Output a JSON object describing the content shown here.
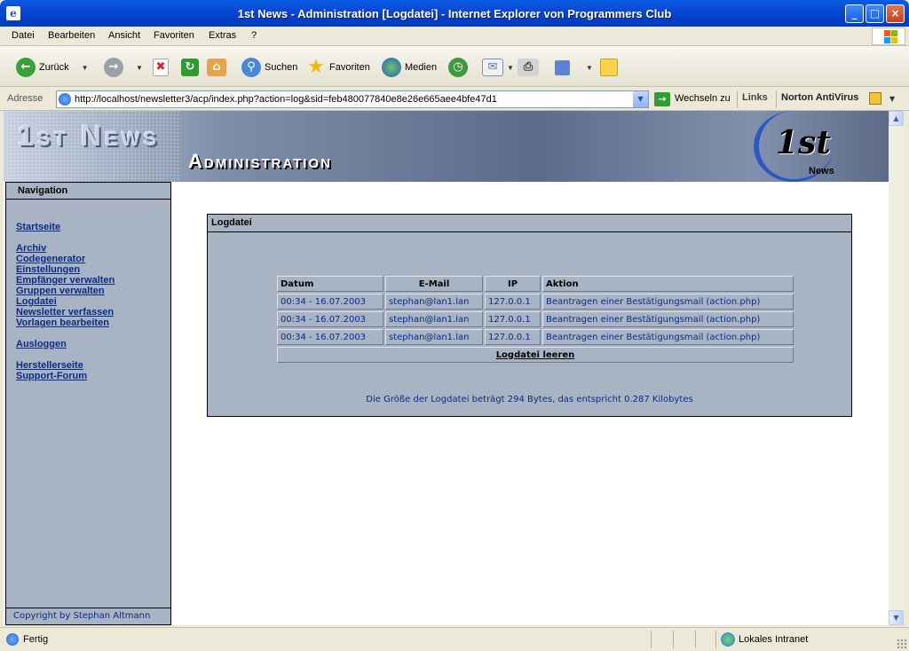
{
  "window": {
    "title": "1st News - Administration [Logdatei] - Internet Explorer von Programmers Club",
    "minimize_glyph": "_",
    "maximize_glyph": "□",
    "close_glyph": "×"
  },
  "menu": {
    "items": [
      {
        "label": "Datei"
      },
      {
        "label": "Bearbeiten"
      },
      {
        "label": "Ansicht"
      },
      {
        "label": "Favoriten"
      },
      {
        "label": "Extras"
      },
      {
        "label": "?"
      }
    ]
  },
  "toolbar": {
    "back_label": "Zurück",
    "search_label": "Suchen",
    "favorites_label": "Favoriten",
    "media_label": "Medien"
  },
  "address": {
    "label": "Adresse",
    "url": "http://localhost/newsletter3/acp/index.php?action=log&sid=feb480077840e8e26e665aee4bfe47d1",
    "go_label": "Wechseln zu",
    "links_label": "Links",
    "norton_label": "Norton AntiVirus"
  },
  "banner": {
    "title": "1st News",
    "subtitle": "Administration",
    "logo_main": "1st",
    "logo_sub": "News"
  },
  "nav": {
    "heading": "Navigation",
    "links": [
      {
        "label": "Startseite"
      },
      {
        "label": "Archiv"
      },
      {
        "label": "Codegenerator"
      },
      {
        "label": "Einstellungen"
      },
      {
        "label": "Empfänger verwalten"
      },
      {
        "label": "Gruppen verwalten"
      },
      {
        "label": "Logdatei"
      },
      {
        "label": "Newsletter verfassen"
      },
      {
        "label": "Vorlagen bearbeiten"
      },
      {
        "label": "Ausloggen"
      },
      {
        "label": "Herstellerseite"
      },
      {
        "label": "Support-Forum"
      }
    ],
    "footer": "Copyright by Stephan Altmann"
  },
  "log": {
    "heading": "Logdatei",
    "columns": {
      "date": "Datum",
      "email": "E-Mail",
      "ip": "IP",
      "action": "Aktion"
    },
    "rows": [
      {
        "date": "00:34 - 16.07.2003",
        "email": "stephan@lan1.lan",
        "ip": "127.0.0.1",
        "action": "Beantragen einer Bestätigungsmail (action.php)"
      },
      {
        "date": "00:34 - 16.07.2003",
        "email": "stephan@lan1.lan",
        "ip": "127.0.0.1",
        "action": "Beantragen einer Bestätigungsmail (action.php)"
      },
      {
        "date": "00:34 - 16.07.2003",
        "email": "stephan@lan1.lan",
        "ip": "127.0.0.1",
        "action": "Beantragen einer Bestätigungsmail (action.php)"
      }
    ],
    "clear_label": "Logdatei leeren",
    "size_text": "Die Größe der Logdatei beträgt 294 Bytes, das entspricht 0.287 Kilobytes"
  },
  "status": {
    "text": "Fertig",
    "zone": "Lokales Intranet"
  },
  "colors": {
    "panel_bg": "#a8b3c4",
    "link": "#0b2c86",
    "titlebar": "#0A48D4"
  }
}
